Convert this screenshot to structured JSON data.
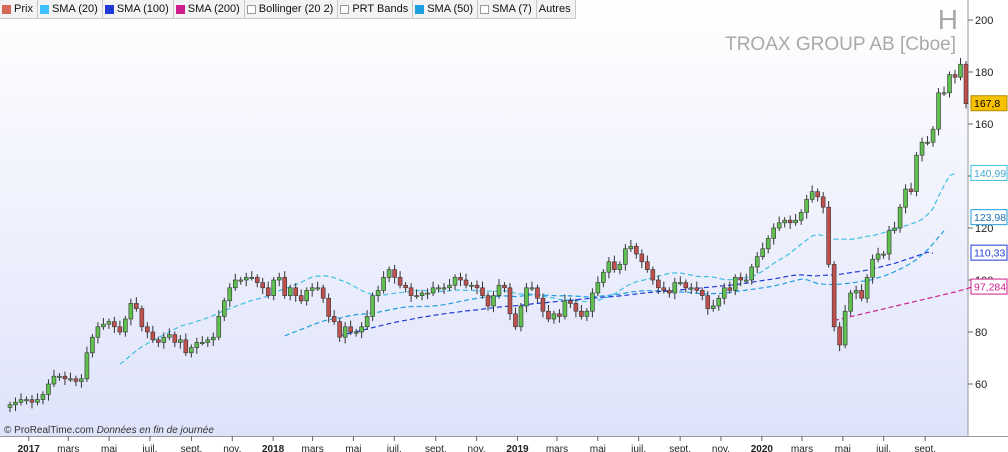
{
  "legend": {
    "items": [
      {
        "label": "Prix",
        "color": "#d46a5a",
        "checked": true
      },
      {
        "label": "SMA (20)",
        "color": "#3fc0ff",
        "checked": true
      },
      {
        "label": "SMA (100)",
        "color": "#1e3ad6",
        "checked": true
      },
      {
        "label": "SMA (200)",
        "color": "#cc1e8c",
        "checked": true
      },
      {
        "label": "Bollinger (20 2)",
        "color": "#ffffff",
        "checked": false
      },
      {
        "label": "PRT Bands",
        "color": "#ffffff",
        "checked": false
      },
      {
        "label": "SMA (50)",
        "color": "#1e9fe0",
        "checked": true
      },
      {
        "label": "SMA (7)",
        "color": "#ffffff",
        "checked": false
      },
      {
        "label": "Autres"
      }
    ]
  },
  "header": {
    "period_letter": "H",
    "instrument": "TROAX GROUP AB [Cboe]"
  },
  "footer": {
    "copyright": "© ProRealTime.com",
    "note": "Données en fin de journée"
  },
  "colors": {
    "up_candle": "#5fbf4f",
    "down_candle": "#c0504d",
    "sma20": "#3fc0e0",
    "sma100": "#1e3ad6",
    "sma200": "#cc1e8c",
    "sma50": "#1e9fe0",
    "last_price_label": "#f6c200"
  },
  "chart_data": {
    "type": "candlestick",
    "frequency": "weekly",
    "ylim": [
      40,
      200
    ],
    "y_ticks": [
      60,
      80,
      100,
      120,
      140,
      160,
      180,
      200
    ],
    "x_ticks": [
      "2017",
      "mars",
      "mai",
      "juil.",
      "sept.",
      "nov.",
      "2018",
      "mars",
      "mai",
      "juil.",
      "sept.",
      "nov.",
      "2019",
      "mars",
      "mai",
      "juil.",
      "sept.",
      "nov.",
      "2020",
      "mars",
      "mai",
      "juil.",
      "sept."
    ],
    "x_range": [
      "2016-11-28",
      "2020-10-26"
    ],
    "value_labels": [
      {
        "series": "Prix",
        "value": "167,8"
      },
      {
        "series": "SMA (20)",
        "value": "140,99"
      },
      {
        "series": "SMA (50)",
        "value": "123,98"
      },
      {
        "series": "SMA (100)",
        "value": "110,33"
      },
      {
        "series": "SMA (200)",
        "value": "97,284"
      }
    ],
    "close": [
      52,
      53,
      54,
      54,
      53,
      54,
      56,
      60,
      63,
      63,
      62,
      62,
      61,
      62,
      72,
      78,
      82,
      83,
      84,
      82,
      80,
      85,
      91,
      89,
      82,
      80,
      77,
      76,
      78,
      79,
      76,
      77,
      72,
      74,
      76,
      76,
      77,
      78,
      86,
      92,
      97,
      100,
      100,
      101,
      101,
      99,
      97,
      94,
      100,
      101,
      94,
      97,
      94,
      92,
      96,
      97,
      97,
      93,
      86,
      84,
      78,
      82,
      80,
      80,
      82,
      86,
      94,
      96,
      101,
      104,
      101,
      98,
      97,
      94,
      94,
      95,
      95,
      97,
      97,
      97,
      98,
      101,
      100,
      98,
      98,
      97,
      94,
      90,
      94,
      98,
      97,
      87,
      82,
      90,
      97,
      97,
      93,
      88,
      85,
      87,
      86,
      92,
      91,
      88,
      86,
      88,
      95,
      99,
      103,
      107,
      104,
      106,
      112,
      113,
      110,
      107,
      104,
      100,
      97,
      96,
      95,
      99,
      99,
      97,
      97,
      96,
      94,
      89,
      90,
      93,
      97,
      96,
      101,
      100,
      100,
      105,
      109,
      112,
      116,
      120,
      122,
      123,
      122,
      123,
      126,
      131,
      134,
      132,
      128,
      106,
      82,
      75,
      88,
      95,
      96,
      93,
      101,
      108,
      110,
      110,
      119,
      120,
      128,
      135,
      134,
      148,
      153,
      153,
      158,
      172,
      172,
      179,
      178,
      183,
      167.8
    ],
    "sma20": [
      null,
      null,
      null,
      null,
      null,
      null,
      null,
      null,
      null,
      null,
      null,
      null,
      null,
      null,
      null,
      null,
      null,
      null,
      null,
      null,
      67.6,
      69.2,
      71.1,
      72.9,
      74.3,
      75.6,
      76.7,
      77.8,
      78.9,
      80.0,
      81.1,
      82.2,
      82.8,
      83.4,
      84.1,
      84.8,
      85.5,
      86.3,
      87.3,
      88.3,
      89.0,
      89.8,
      90.6,
      91.4,
      92.1,
      92.7,
      93.2,
      93.9,
      94.9,
      95.9,
      96.7,
      97.5,
      98.3,
      99.1,
      100.2,
      101.1,
      101.5,
      101.7,
      101.4,
      100.9,
      100.0,
      99.4,
      98.3,
      97.1,
      96.0,
      95.0,
      94.4,
      94.0,
      94.2,
      94.6,
      94.9,
      95.1,
      95.4,
      95.7,
      95.9,
      96.0,
      95.9,
      95.9,
      95.7,
      95.6,
      95.9,
      96.1,
      96.1,
      96.0,
      96.0,
      95.9,
      95.8,
      95.7,
      95.7,
      95.8,
      95.9,
      95.6,
      94.9,
      94.6,
      94.6,
      94.6,
      94.2,
      93.8,
      93.4,
      93.0,
      92.5,
      92.4,
      92.2,
      92.1,
      91.9,
      91.6,
      91.8,
      92.2,
      92.8,
      93.6,
      94.6,
      96.0,
      97.4,
      98.5,
      99.3,
      99.8,
      100.3,
      100.9,
      101.5,
      102.0,
      102.6,
      102.7,
      102.7,
      102.3,
      101.9,
      101.4,
      101.3,
      101.3,
      101.1,
      100.6,
      100.2,
      100.1,
      100.3,
      100.6,
      100.9,
      101.3,
      102.2,
      103.4,
      104.9,
      106.4,
      107.7,
      108.9,
      110.3,
      112.1,
      113.8,
      115.4,
      116.9,
      117.6,
      117.0,
      116.0,
      115.7,
      115.7,
      115.7,
      115.6,
      115.9,
      116.4,
      116.8,
      117.0,
      117.6,
      118.2,
      119.0,
      119.7,
      120.1,
      120.9,
      121.5,
      122.3,
      123.3,
      125.1,
      127.5,
      132.1,
      136.3,
      140.1,
      141.0
    ],
    "sma50": [
      null,
      null,
      null,
      null,
      null,
      null,
      null,
      null,
      null,
      null,
      null,
      null,
      null,
      null,
      null,
      null,
      null,
      null,
      null,
      null,
      null,
      null,
      null,
      null,
      null,
      null,
      null,
      null,
      null,
      null,
      null,
      null,
      null,
      null,
      null,
      null,
      null,
      null,
      null,
      null,
      null,
      null,
      null,
      null,
      null,
      null,
      null,
      null,
      null,
      null,
      78.5,
      79.4,
      80.2,
      81.0,
      81.8,
      82.7,
      83.5,
      84.2,
      84.7,
      85.1,
      85.4,
      85.9,
      86.3,
      86.7,
      86.9,
      87.0,
      87.4,
      87.6,
      88.0,
      88.5,
      88.9,
      89.3,
      89.6,
      89.8,
      89.8,
      89.8,
      89.9,
      90.0,
      90.2,
      90.5,
      90.9,
      91.3,
      91.8,
      92.2,
      92.6,
      92.9,
      93.3,
      93.5,
      93.6,
      93.8,
      93.9,
      93.8,
      93.6,
      93.8,
      94.1,
      94.3,
      94.3,
      94.2,
      94.1,
      94.0,
      93.9,
      94.0,
      93.9,
      93.8,
      93.6,
      93.5,
      93.5,
      93.7,
      93.9,
      94.1,
      94.3,
      94.6,
      95.0,
      95.3,
      95.6,
      95.8,
      95.9,
      95.9,
      95.8,
      95.7,
      95.6,
      95.5,
      95.4,
      95.3,
      95.1,
      94.9,
      94.7,
      94.7,
      94.8,
      94.8,
      94.9,
      95.2,
      95.6,
      95.8,
      96.1,
      96.4,
      96.7,
      97.0,
      97.3,
      97.7,
      98.2,
      98.7,
      99.3,
      99.8,
      100.3,
      100.1,
      99.4,
      98.6,
      98.4,
      98.3,
      98.2,
      98.4,
      98.6,
      98.8,
      99.1,
      99.5,
      99.7,
      100.2,
      100.9,
      101.5,
      102.3,
      103.2,
      104.2,
      105.3,
      106.5,
      107.9,
      109.7,
      111.6,
      113.9,
      116.5,
      118.9
    ],
    "sma100": [
      null,
      null,
      null,
      null,
      null,
      null,
      null,
      null,
      null,
      null,
      null,
      null,
      null,
      null,
      null,
      null,
      null,
      null,
      null,
      null,
      null,
      null,
      null,
      null,
      null,
      null,
      null,
      null,
      null,
      null,
      null,
      null,
      null,
      null,
      null,
      null,
      null,
      null,
      null,
      null,
      null,
      null,
      null,
      null,
      null,
      null,
      null,
      null,
      null,
      null,
      null,
      null,
      null,
      null,
      null,
      null,
      null,
      null,
      null,
      null,
      78.6,
      79.1,
      79.6,
      80.1,
      80.6,
      81.1,
      81.7,
      82.2,
      82.7,
      83.2,
      83.7,
      84.1,
      84.5,
      84.9,
      85.3,
      85.7,
      86.0,
      86.4,
      86.7,
      87.0,
      87.3,
      87.5,
      87.8,
      88.1,
      88.3,
      88.5,
      88.8,
      89.1,
      89.3,
      89.6,
      89.8,
      90.0,
      90.1,
      90.3,
      90.5,
      90.8,
      91.0,
      91.2,
      91.4,
      91.6,
      91.8,
      92.0,
      92.2,
      92.4,
      92.6,
      92.8,
      93.0,
      93.2,
      93.4,
      93.5,
      93.7,
      93.9,
      94.1,
      94.4,
      94.6,
      94.9,
      95.1,
      95.3,
      95.5,
      95.7,
      95.8,
      96.0,
      96.2,
      96.4,
      96.6,
      96.8,
      97.0,
      97.2,
      97.4,
      97.6,
      97.8,
      98.0,
      98.2,
      98.5,
      98.8,
      99.1,
      99.5,
      99.8,
      100.1,
      100.4,
      100.8,
      101.2,
      101.6,
      101.9,
      102.0,
      101.8,
      101.6,
      101.6,
      101.8,
      101.9,
      102.0,
      102.2,
      102.5,
      102.8,
      103.1,
      103.4,
      103.8,
      104.3,
      104.8,
      105.3,
      105.9,
      106.4,
      107.1,
      107.8,
      108.5,
      109.2,
      110.0,
      110.7,
      110.3
    ],
    "sma200": [
      null,
      null,
      null,
      null,
      null,
      null,
      null,
      null,
      null,
      null,
      null,
      null,
      null,
      null,
      null,
      null,
      null,
      null,
      null,
      null,
      null,
      null,
      null,
      null,
      null,
      null,
      null,
      null,
      null,
      null,
      null,
      null,
      null,
      null,
      null,
      null,
      null,
      null,
      null,
      null,
      null,
      null,
      null,
      null,
      null,
      null,
      null,
      null,
      null,
      null,
      null,
      null,
      null,
      null,
      null,
      null,
      null,
      null,
      null,
      null,
      null,
      null,
      null,
      null,
      null,
      null,
      null,
      null,
      null,
      null,
      null,
      null,
      null,
      null,
      null,
      null,
      null,
      null,
      null,
      null,
      null,
      null,
      null,
      null,
      null,
      null,
      null,
      null,
      null,
      null,
      null,
      null,
      null,
      null,
      null,
      null,
      null,
      null,
      null,
      null,
      null,
      null,
      null,
      null,
      null,
      null,
      null,
      null,
      null,
      null,
      null,
      null,
      null,
      null,
      null,
      null,
      null,
      null,
      null,
      null,
      null,
      null,
      null,
      null,
      null,
      null,
      null,
      null,
      null,
      null,
      null,
      null,
      null,
      null,
      null,
      null,
      null,
      null,
      null,
      null,
      null,
      null,
      null,
      null,
      null,
      null,
      null,
      null,
      null,
      null,
      84.4,
      84.9,
      85.4,
      85.9,
      86.4,
      86.9,
      87.4,
      87.9,
      88.4,
      88.9,
      89.4,
      89.9,
      90.4,
      90.9,
      91.4,
      91.9,
      92.4,
      92.9,
      93.4,
      93.9,
      94.4,
      94.9,
      95.4,
      96.0,
      96.5,
      97.3
    ]
  }
}
